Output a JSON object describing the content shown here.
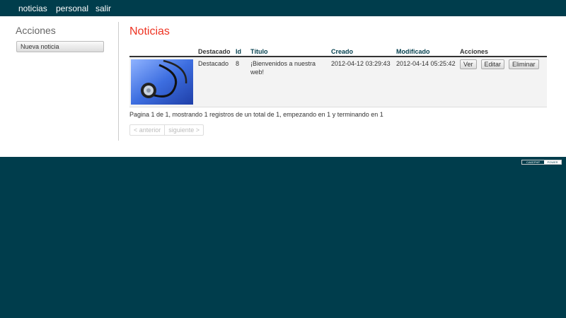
{
  "nav": {
    "items": [
      "noticias",
      "personal",
      "salir"
    ]
  },
  "sidebar": {
    "title": "Acciones",
    "new_button": "Nueva noticia"
  },
  "main": {
    "title": "Noticias",
    "columns": [
      "Destacado",
      "Id",
      "Título",
      "Creado",
      "Modificado",
      "Acciones"
    ],
    "row": {
      "destacado": "Destacado",
      "id": "8",
      "titulo": "¡Bienvenidos a nuestra web!",
      "creado": "2012-04-12 03:29:43",
      "modificado": "2012-04-14 05:25:42",
      "actions": [
        "Ver",
        "Editar",
        "Eliminar"
      ]
    },
    "paging_text": "Pagina 1 de 1, mostrando 1 registros de un total de 1, empezando en 1 y terminando en 1",
    "prev": "< anterior",
    "next": "siguiente >"
  },
  "footer": {
    "powered_left": "CAKEPHP",
    "powered_right": "POWER"
  },
  "colors": {
    "brand": "#003d4c",
    "title_red": "#ee3322"
  }
}
